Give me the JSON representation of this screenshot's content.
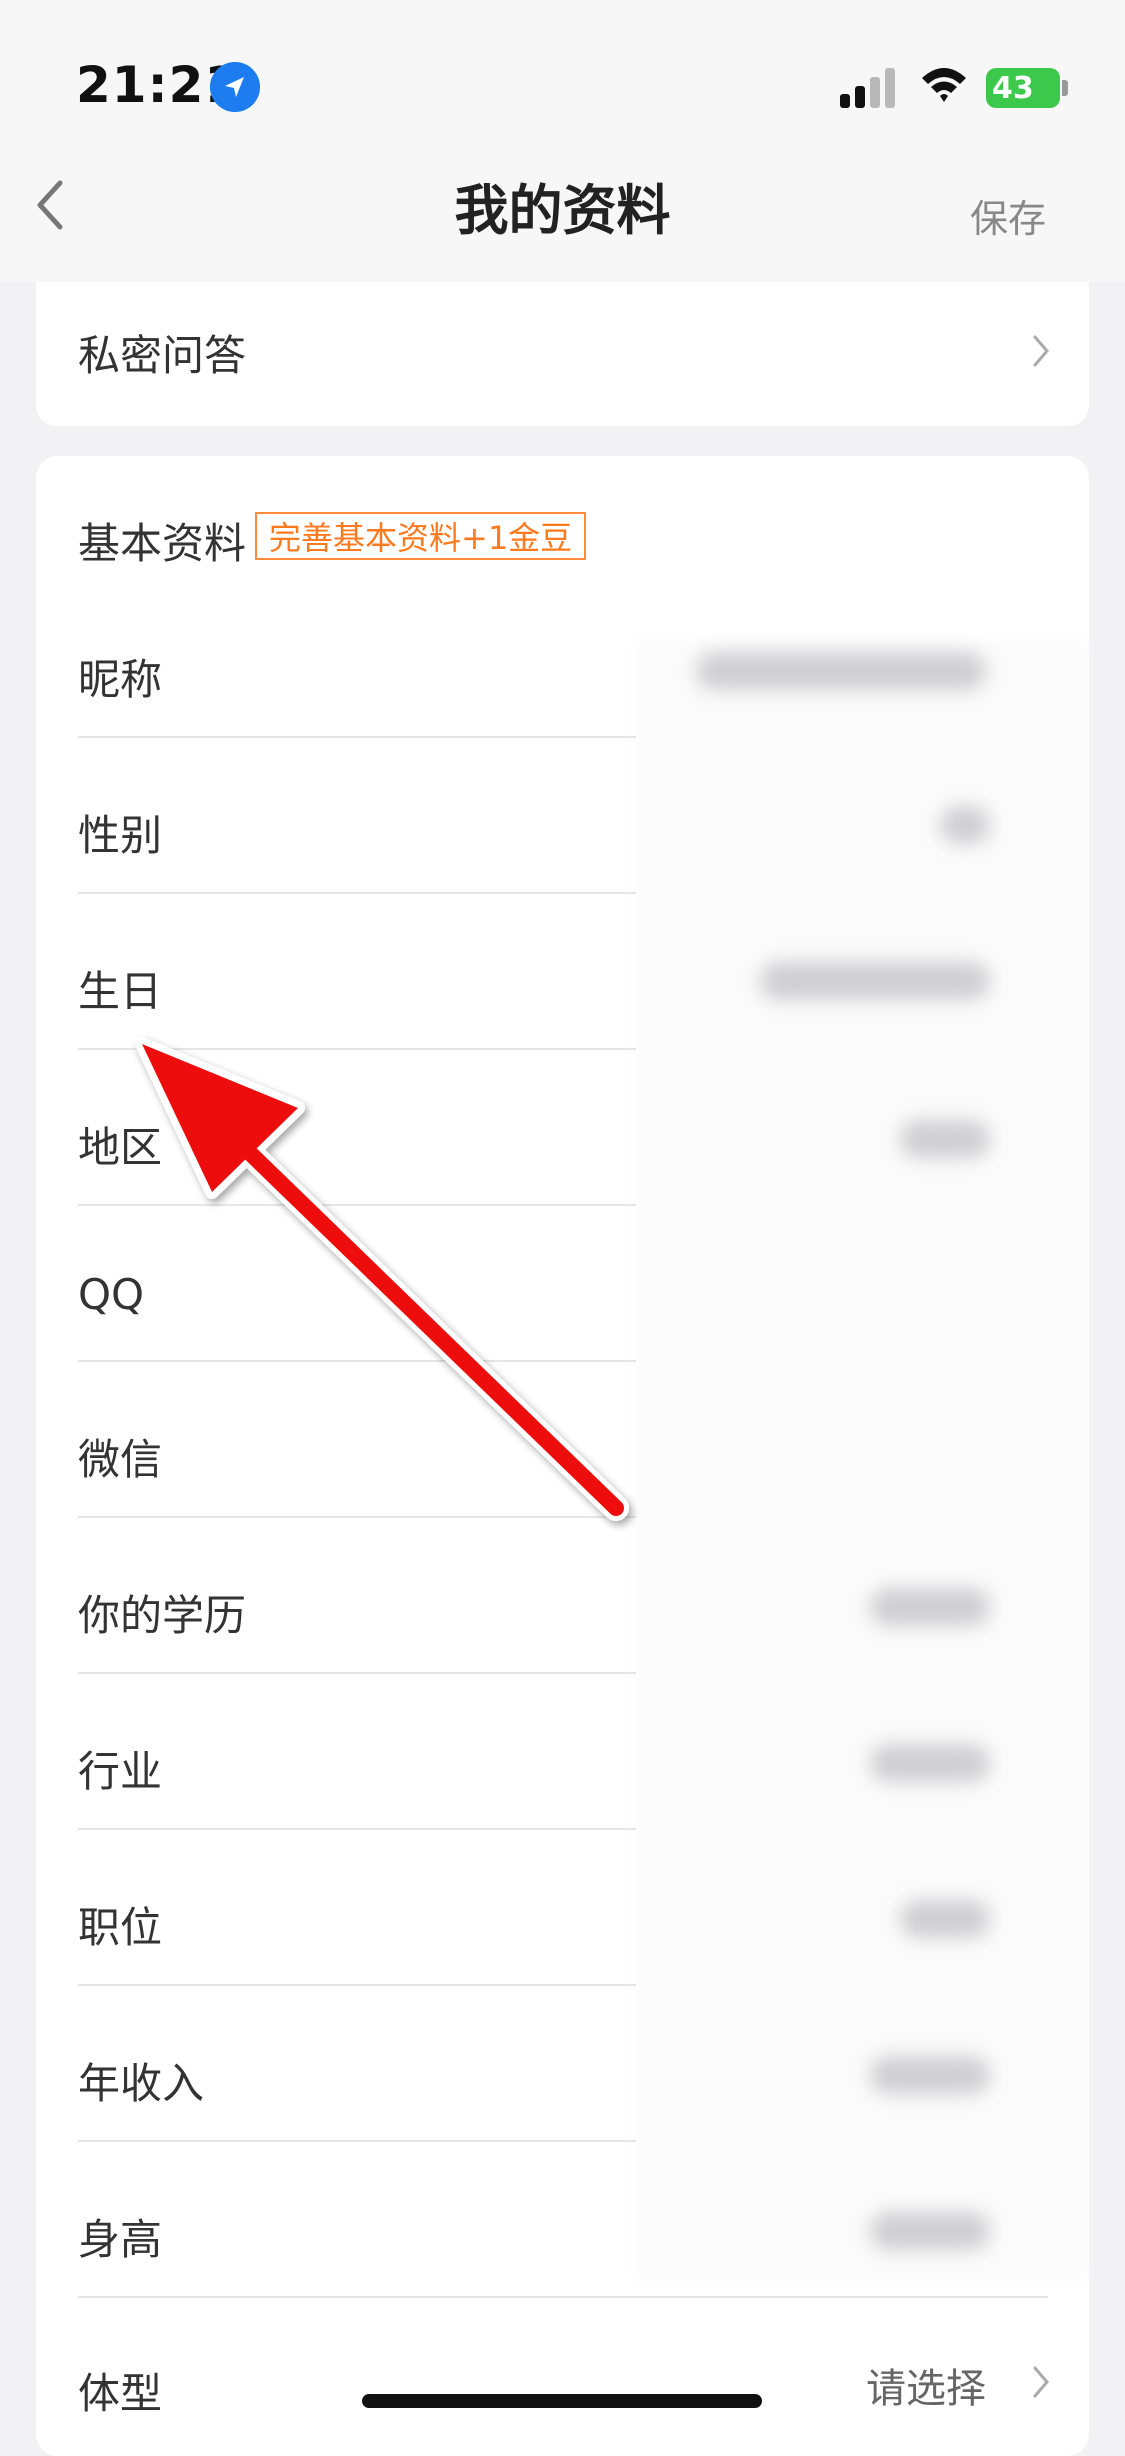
{
  "status_bar": {
    "time": "21:21",
    "battery": "43",
    "battery_color": "#3cc84a",
    "icons": [
      "location-arrow-icon",
      "cellular-signal-icon",
      "wifi-icon",
      "battery-icon"
    ]
  },
  "nav": {
    "title": "我的资料",
    "save_label": "保存",
    "back_icon": "chevron-left-icon"
  },
  "privacy": {
    "label": "私密问答"
  },
  "basic": {
    "title": "基本资料",
    "badge": "完善基本资料+1金豆",
    "badge_color": "#ff7a1f",
    "rows": [
      {
        "label": "昵称"
      },
      {
        "label": "性别"
      },
      {
        "label": "生日"
      },
      {
        "label": "地区"
      },
      {
        "label": "QQ"
      },
      {
        "label": "微信"
      },
      {
        "label": "你的学历"
      },
      {
        "label": "行业"
      },
      {
        "label": "职位"
      },
      {
        "label": "年收入"
      },
      {
        "label": "身高"
      },
      {
        "label": "体型",
        "value": "请选择"
      }
    ]
  },
  "annotation": {
    "arrow_color": "#ee1111"
  }
}
